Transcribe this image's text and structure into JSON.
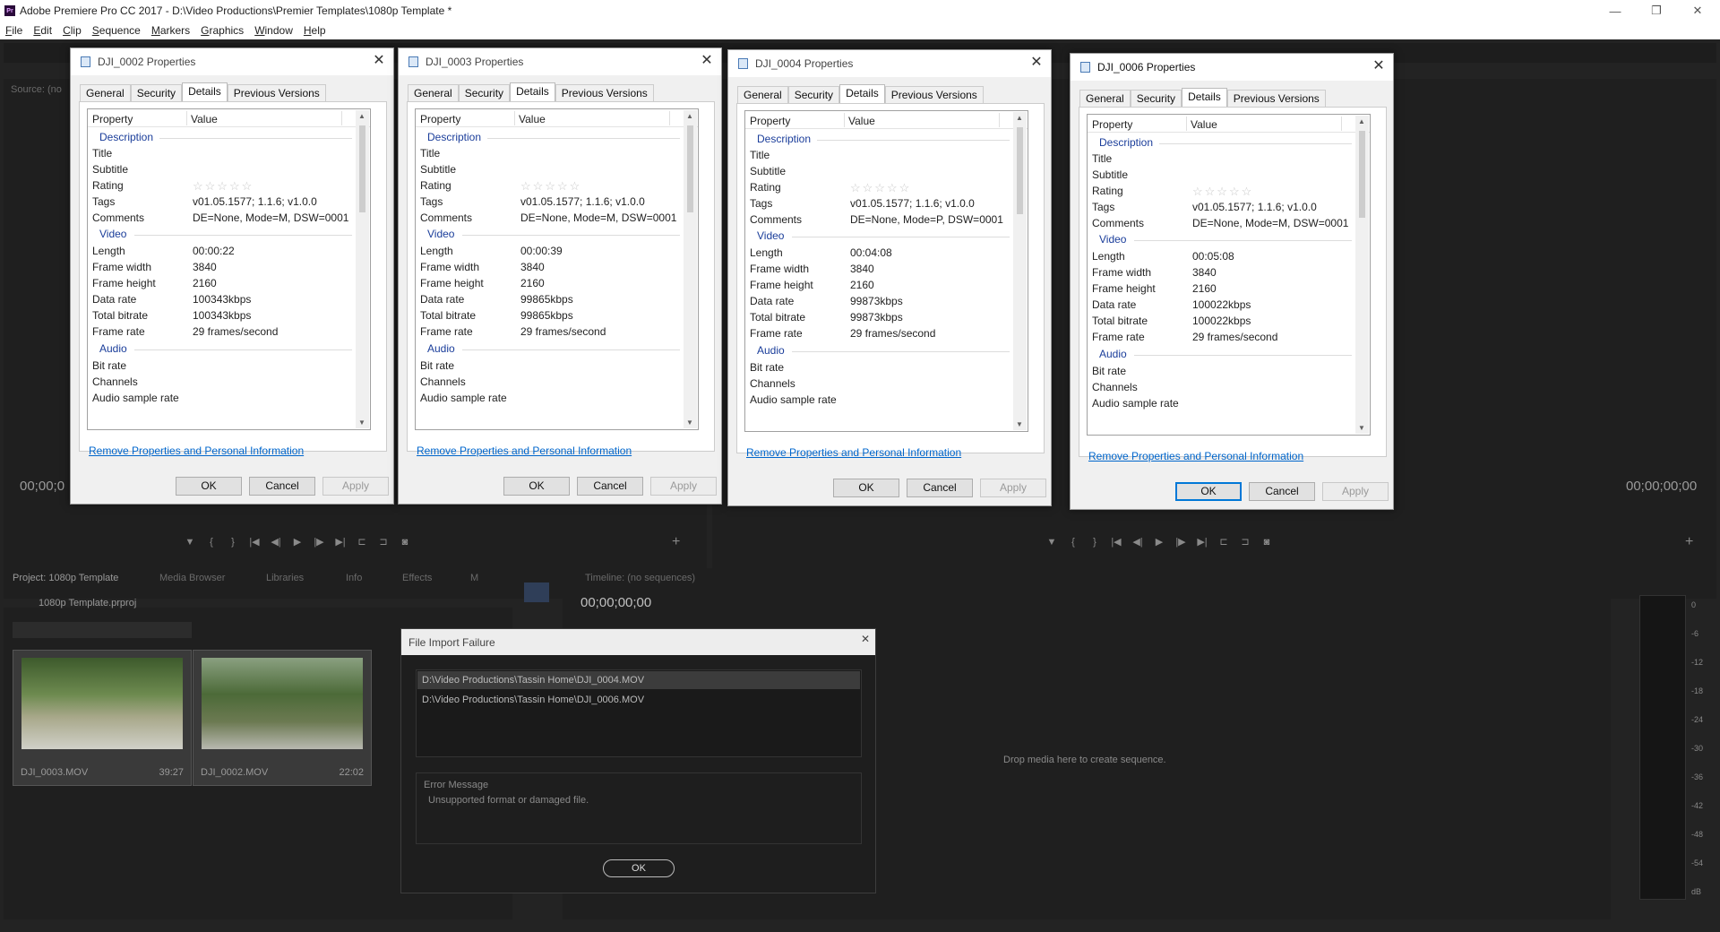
{
  "app": {
    "title": "Adobe Premiere Pro CC 2017 - D:\\Video Productions\\Premier Templates\\1080p Template *",
    "logo": "Pr"
  },
  "window_controls": {
    "minimize": "—",
    "restore": "❐",
    "close": "✕"
  },
  "menu": [
    "File",
    "Edit",
    "Clip",
    "Sequence",
    "Markers",
    "Graphics",
    "Window",
    "Help"
  ],
  "workspace": {
    "source_label": "Source: (no",
    "source_tc": "00;00;0",
    "program_tc": "00;00;00;00",
    "project_tab": "Project: 1080p Template",
    "panel_tabs": [
      "Media Browser",
      "Libraries",
      "Info",
      "Effects",
      "M"
    ],
    "project_file": "1080p Template.prproj",
    "timeline_tab": "Timeline: (no sequences)",
    "timeline_tc": "00;00;00;00",
    "drop_text": "Drop media here to create sequence.",
    "meter_scale": [
      "0",
      "-6",
      "-12",
      "-18",
      "-24",
      "-30",
      "-36",
      "-42",
      "-48",
      "-54",
      "dB"
    ],
    "clips": [
      {
        "name": "DJI_0003.MOV",
        "duration": "39:27"
      },
      {
        "name": "DJI_0002.MOV",
        "duration": "22:02"
      }
    ]
  },
  "dialogs": [
    {
      "title": "DJI_0002 Properties",
      "tabs": [
        "General",
        "Security",
        "Details",
        "Previous Versions"
      ],
      "comments": "DE=None, Mode=M, DSW=0001",
      "length": "00:00:22",
      "data_rate": "100343kbps",
      "total_bitrate": "100343kbps"
    },
    {
      "title": "DJI_0003 Properties",
      "tabs": [
        "General",
        "Security",
        "Details",
        "Previous Versions"
      ],
      "comments": "DE=None, Mode=M, DSW=0001",
      "length": "00:00:39",
      "data_rate": "99865kbps",
      "total_bitrate": "99865kbps"
    },
    {
      "title": "DJI_0004 Properties",
      "tabs": [
        "General",
        "Security",
        "Details",
        "Previous Versions"
      ],
      "comments": "DE=None, Mode=P, DSW=0001",
      "length": "00:04:08",
      "data_rate": "99873kbps",
      "total_bitrate": "99873kbps"
    },
    {
      "title": "DJI_0006 Properties",
      "tabs": [
        "General",
        "Security",
        "Details",
        "Previous Versions"
      ],
      "comments": "DE=None, Mode=M, DSW=0001",
      "length": "00:05:08",
      "data_rate": "100022kbps",
      "total_bitrate": "100022kbps"
    }
  ],
  "common": {
    "col_property": "Property",
    "col_value": "Value",
    "sec_description": "Description",
    "sec_video": "Video",
    "sec_audio": "Audio",
    "title": "Title",
    "subtitle": "Subtitle",
    "rating": "Rating",
    "stars": "☆☆☆☆☆",
    "tags": "Tags",
    "tags_value": "v01.05.1577; 1.1.6; v1.0.0",
    "comments": "Comments",
    "length": "Length",
    "frame_width": "Frame width",
    "frame_width_value": "3840",
    "frame_height": "Frame height",
    "frame_height_value": "2160",
    "data_rate": "Data rate",
    "total_bitrate": "Total bitrate",
    "frame_rate": "Frame rate",
    "frame_rate_value": "29 frames/second",
    "bit_rate": "Bit rate",
    "channels": "Channels",
    "audio_sample_rate": "Audio sample rate",
    "remove_link": "Remove Properties and Personal Information",
    "ok": "OK",
    "cancel": "Cancel",
    "apply": "Apply"
  },
  "import_failure": {
    "title": "File Import Failure",
    "files": [
      "D:\\Video Productions\\Tassin Home\\DJI_0004.MOV",
      "D:\\Video Productions\\Tassin Home\\DJI_0006.MOV"
    ],
    "error_label": "Error Message",
    "error_message": "Unsupported format or damaged file.",
    "ok": "OK"
  }
}
